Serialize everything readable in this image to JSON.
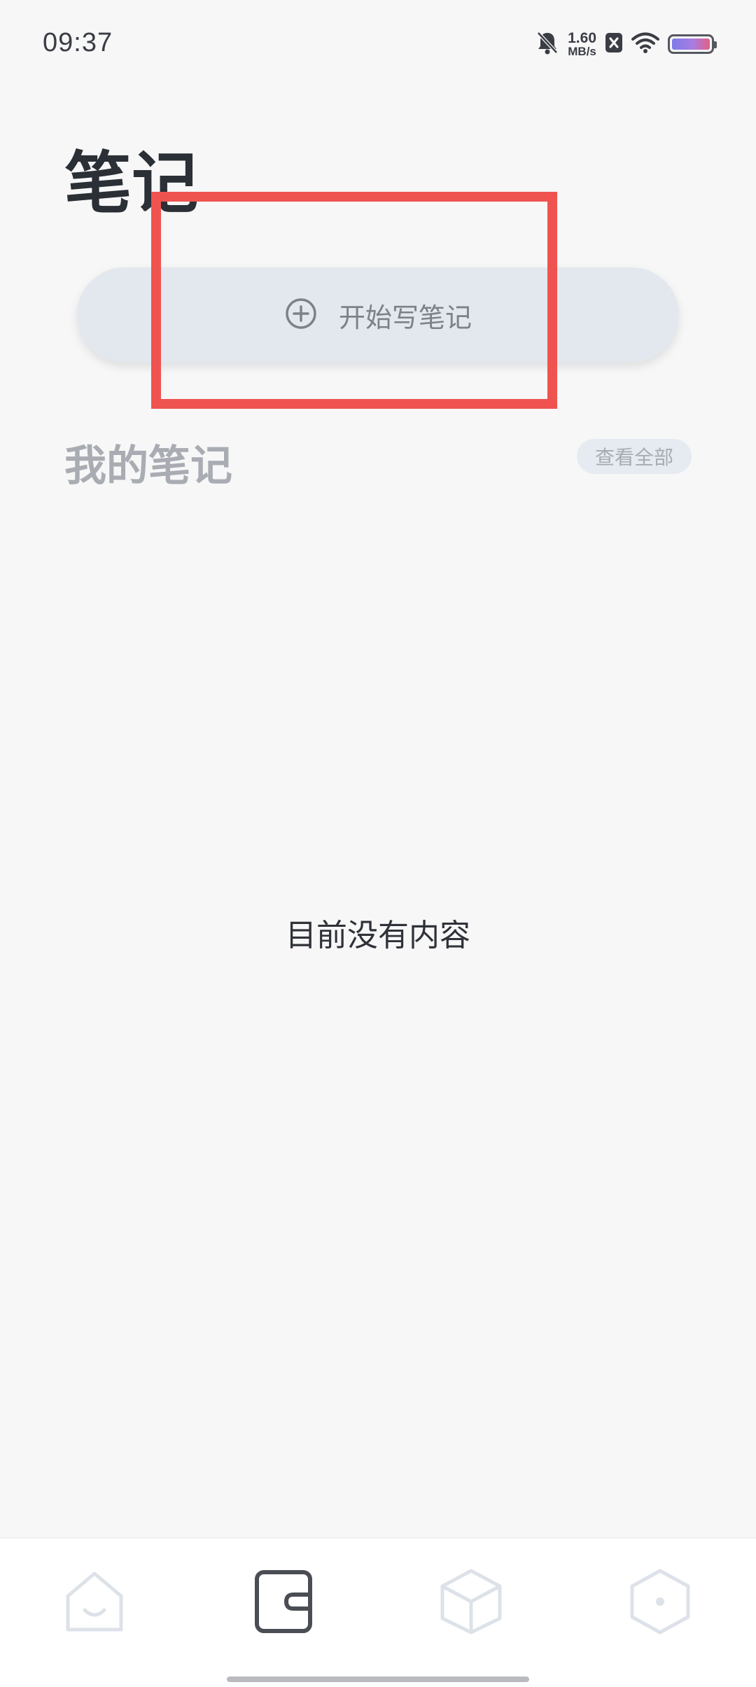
{
  "status_bar": {
    "time": "09:37",
    "net_speed_value": "1.60",
    "net_speed_unit": "MB/s",
    "icons": [
      "bell-muted-icon",
      "x-notification-icon",
      "wifi-icon",
      "battery-icon"
    ]
  },
  "header": {
    "title": "笔记"
  },
  "start_button": {
    "label": "开始写笔记",
    "icon": "plus-circle-icon"
  },
  "my_notes": {
    "title": "我的笔记",
    "view_all_label": "查看全部",
    "empty_text": "目前没有内容"
  },
  "bottom_nav": {
    "items": [
      {
        "name": "home",
        "icon": "home-icon",
        "active": false
      },
      {
        "name": "notes",
        "icon": "wallet-icon",
        "active": true
      },
      {
        "name": "cube",
        "icon": "cube-icon",
        "active": false
      },
      {
        "name": "settings",
        "icon": "hexagon-icon",
        "active": false
      }
    ]
  },
  "colors": {
    "background": "#f7f7f8",
    "highlight": "#ef5350",
    "button_bg": "#e3e8ee",
    "active_icon": "#4a4d54",
    "inactive_icon": "#dde2e9"
  }
}
